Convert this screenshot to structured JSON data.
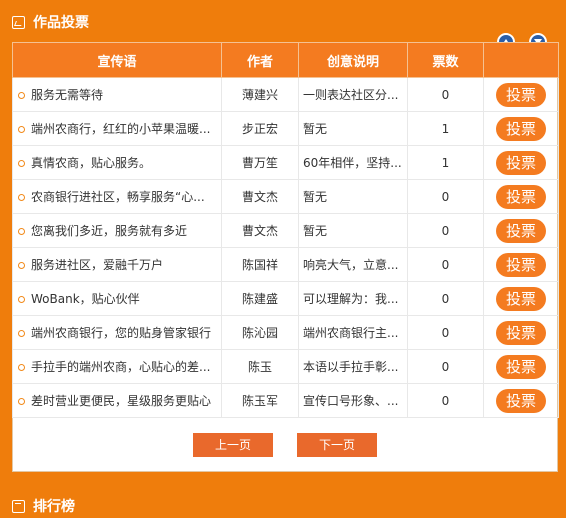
{
  "header": {
    "title": "作品投票"
  },
  "table": {
    "columns": [
      "宣传语",
      "作者",
      "创意说明",
      "票数"
    ],
    "vote_label": "投票",
    "rows": [
      {
        "slogan": "服务无需等待",
        "author": "薄建兴",
        "desc": "一则表达社区分...",
        "count": "0"
      },
      {
        "slogan": "端州农商行，红红的小苹果温暖...",
        "author": "步正宏",
        "desc": "暂无",
        "count": "1"
      },
      {
        "slogan": "真情农商，贴心服务。",
        "author": "曹万笙",
        "desc": "60年相伴，坚持...",
        "count": "1"
      },
      {
        "slogan": "农商银行进社区，畅享服务“心...",
        "author": "曹文杰",
        "desc": "暂无",
        "count": "0"
      },
      {
        "slogan": "您离我们多近，服务就有多近",
        "author": "曹文杰",
        "desc": "暂无",
        "count": "0"
      },
      {
        "slogan": "服务进社区，爱融千万户",
        "author": "陈国祥",
        "desc": "响亮大气，立意...",
        "count": "0"
      },
      {
        "slogan": "WoBank，贴心伙伴",
        "author": "陈建盛",
        "desc": "可以理解为：我...",
        "count": "0"
      },
      {
        "slogan": "端州农商银行，您的贴身管家银行",
        "author": "陈沁园",
        "desc": "端州农商银行主...",
        "count": "0"
      },
      {
        "slogan": "手拉手的端州农商，心贴心的差...",
        "author": "陈玉",
        "desc": "本语以手拉手彰...",
        "count": "0"
      },
      {
        "slogan": "差时营业更便民，星级服务更贴心",
        "author": "陈玉军",
        "desc": "宣传口号形象、...",
        "count": "0"
      }
    ]
  },
  "pager": {
    "prev": "上一页",
    "next": "下一页"
  },
  "ranking": {
    "title": "排行榜"
  },
  "colors": {
    "accent": "#ef7d0c",
    "header_bg": "#f47b20",
    "arrow": "#2a5ea8"
  }
}
